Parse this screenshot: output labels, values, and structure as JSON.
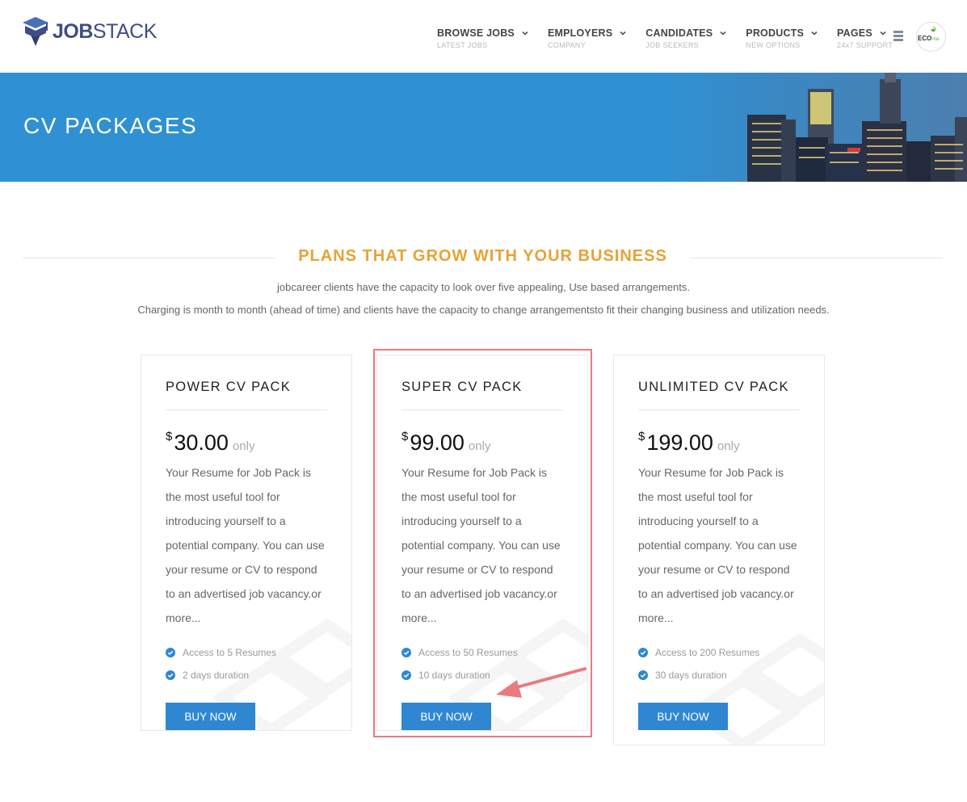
{
  "brand": {
    "name_bold": "JOB",
    "name_light": "STACK"
  },
  "nav": [
    {
      "label": "BROWSE JOBS",
      "sub": "LATEST JOBS"
    },
    {
      "label": "EMPLOYERS",
      "sub": "COMPANY"
    },
    {
      "label": "CANDIDATES",
      "sub": "JOB SEEKERS"
    },
    {
      "label": "PRODUCTS",
      "sub": "NEW OPTIONS"
    },
    {
      "label": "PAGES",
      "sub": "24x7 SUPPORT"
    }
  ],
  "avatar_text": "ECO",
  "banner": {
    "title": "CV PACKAGES"
  },
  "section": {
    "title": "PLANS THAT GROW WITH YOUR BUSINESS",
    "intro_1": "jobcareer clients have the capacity to look over five appealing, Use based arrangements.",
    "intro_2": "Charging is month to month (ahead of time) and clients have the capacity to change arrangementsto fit their changing business and utilization needs."
  },
  "packages": [
    {
      "title": "POWER CV PACK",
      "currency": "$",
      "price": "30.00",
      "price_suffix": "only",
      "description": "Your Resume for Job Pack is the most useful tool for introducing yourself to a potential company. You can use your resume or CV to respond to an advertised job vacancy.or more...",
      "features": [
        "Access to 5 Resumes",
        "2 days duration"
      ],
      "button": "BUY NOW"
    },
    {
      "title": "SUPER CV PACK",
      "currency": "$",
      "price": "99.00",
      "price_suffix": "only",
      "description": "Your Resume for Job Pack is the most useful tool for introducing yourself to a potential company. You can use your resume or CV to respond to an advertised job vacancy.or more...",
      "features": [
        "Access to 50 Resumes",
        "10 days duration"
      ],
      "button": "BUY NOW"
    },
    {
      "title": "UNLIMITED CV PACK",
      "currency": "$",
      "price": "199.00",
      "price_suffix": "only",
      "description": "Your Resume for Job Pack is the most useful tool for introducing yourself to a potential company. You can use your resume or CV to respond to an advertised job vacancy.or more...",
      "features": [
        "Access to 200 Resumes",
        "30 days duration"
      ],
      "button": "BUY NOW"
    }
  ],
  "colors": {
    "brand_navy": "#3e4d86",
    "banner_blue": "#2f91d3",
    "accent_orange": "#e8a233",
    "button_blue": "#2f87d1",
    "highlight_red": "#ea7a7e"
  },
  "icons": [
    "jobstack-logo-icon",
    "chevron-down-icon",
    "hamburger-menu-icon",
    "check-circle-icon",
    "arrow-annotation"
  ]
}
